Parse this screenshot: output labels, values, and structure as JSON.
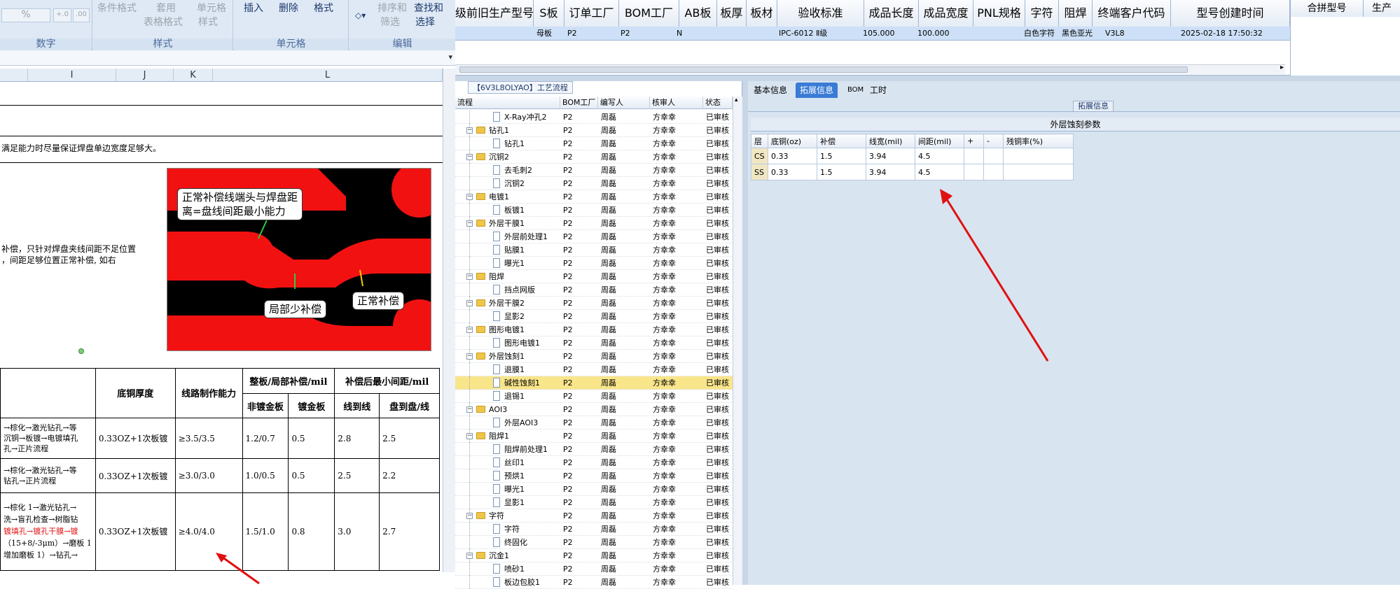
{
  "excel": {
    "ribbon": {
      "groups": [
        {
          "label": "数字",
          "items": [
            "%",
            "+.0",
            ".00"
          ]
        },
        {
          "label": "样式",
          "items": [
            "条件格式",
            "套用",
            "表格格式",
            "单元格",
            "样式"
          ]
        },
        {
          "label": "单元格",
          "items": [
            "插入",
            "删除",
            "格式"
          ]
        },
        {
          "label": "编辑",
          "items": [
            "排序和",
            "筛选",
            "查找和",
            "选择"
          ]
        }
      ]
    },
    "columns": [
      "I",
      "J",
      "K",
      "L"
    ],
    "note_top": "满足能力时尽量保证焊盘单边宽度足够大。",
    "note_left_1": "补偿，只针对焊盘夹线间距不足位置",
    "note_left_2": "，间距足够位置正常补偿, 如右",
    "callouts": {
      "c1_l1": "正常补偿线端头与焊盘距",
      "c1_l2": "离=盘线间距最小能力",
      "c2": "局部少补偿",
      "c3": "正常补偿"
    },
    "table": {
      "h_copper": "底铜厚度",
      "h_capability": "线路制作能力",
      "h_comp": "整板/局部补偿/mil",
      "h_min": "补偿后最小间距/mil",
      "h_nonplated": "非镀金板",
      "h_plated": "镀金板",
      "h_l2l": "线到线",
      "h_p2l": "盘到盘/线",
      "rows": [
        {
          "flow_1": "→棕化→激光钻孔→等",
          "flow_2": "沉铜→板镀→电镀填孔",
          "flow_3": "孔→正片流程",
          "copper": "0.33OZ+1次板镀",
          "cap": "≥3.5/3.5",
          "nonplated": "1.2/0.7",
          "plated": "0.5",
          "l2l": "2.8",
          "p2l": "2.5"
        },
        {
          "flow_1": "→棕化→激光钻孔→等",
          "flow_2": "钻孔→正片流程",
          "flow_3": "",
          "copper": "0.33OZ+1次板镀",
          "cap": "≥3.0/3.0",
          "nonplated": "1.0/0.5",
          "plated": "0.5",
          "l2l": "2.5",
          "p2l": "2.2"
        },
        {
          "flow_1": "→棕化 1→激光钻孔→",
          "flow_2": "洗→盲孔检查→树脂钻",
          "flow_3": "镀填孔→镀孔干膜→镀",
          "flow_4": "（15+8/-3μm）→磨板 1",
          "flow_5": "增加磨板 1）→钻孔→",
          "copper": "0.33OZ+1次板镀",
          "cap": "≥4.0/4.0",
          "nonplated": "1.5/1.0",
          "plated": "0.8",
          "l2l": "3.0",
          "p2l": "2.7"
        }
      ]
    }
  },
  "app": {
    "grid_headers": [
      "级前旧生产型号",
      "S板",
      "订单工厂",
      "BOM工厂",
      "AB板",
      "板厚",
      "板材",
      "验收标准",
      "成品长度",
      "成品宽度",
      "PNL规格",
      "字符",
      "阻焊",
      "终端客户代码",
      "型号创建时间"
    ],
    "grid_row": {
      "s_board": "母板",
      "order_factory": "P2",
      "bom_factory": "P2",
      "ab": "N",
      "standard": "IPC-6012 Ⅱ级",
      "length": "105.000",
      "width": "100.000",
      "char": "白色字符",
      "solder": "黑色亚光",
      "customer": "V3L8",
      "created": "2025-02-18 17:50:32"
    },
    "right_grid_headers": [
      "合拼型号",
      "生产"
    ],
    "tree": {
      "title": "【6V3L8OLYAO】工艺流程",
      "headers": [
        "流程",
        "BOM工厂",
        "编写人",
        "核审人",
        "状态"
      ],
      "rows": [
        {
          "name": "X-Ray冲孔2",
          "type": "doc",
          "level": 2,
          "factory": "P2",
          "writer": "周磊",
          "reviewer": "方幸幸",
          "status": "已审核"
        },
        {
          "name": "钻孔1",
          "type": "folder",
          "level": 1,
          "factory": "P2",
          "writer": "周磊",
          "reviewer": "方幸幸",
          "status": "已审核"
        },
        {
          "name": "钻孔1",
          "type": "doc",
          "level": 2,
          "factory": "P2",
          "writer": "周磊",
          "reviewer": "方幸幸",
          "status": "已审核"
        },
        {
          "name": "沉铜2",
          "type": "folder",
          "level": 1,
          "factory": "P2",
          "writer": "周磊",
          "reviewer": "方幸幸",
          "status": "已审核"
        },
        {
          "name": "去毛刺2",
          "type": "doc",
          "level": 2,
          "factory": "P2",
          "writer": "周磊",
          "reviewer": "方幸幸",
          "status": "已审核"
        },
        {
          "name": "沉铜2",
          "type": "doc",
          "level": 2,
          "factory": "P2",
          "writer": "周磊",
          "reviewer": "方幸幸",
          "status": "已审核"
        },
        {
          "name": "电镀1",
          "type": "folder",
          "level": 1,
          "factory": "P2",
          "writer": "周磊",
          "reviewer": "方幸幸",
          "status": "已审核"
        },
        {
          "name": "板镀1",
          "type": "doc",
          "level": 2,
          "factory": "P2",
          "writer": "周磊",
          "reviewer": "方幸幸",
          "status": "已审核"
        },
        {
          "name": "外层干膜1",
          "type": "folder",
          "level": 1,
          "factory": "P2",
          "writer": "周磊",
          "reviewer": "方幸幸",
          "status": "已审核"
        },
        {
          "name": "外层前处理1",
          "type": "doc",
          "level": 2,
          "factory": "P2",
          "writer": "周磊",
          "reviewer": "方幸幸",
          "status": "已审核"
        },
        {
          "name": "贴膜1",
          "type": "doc",
          "level": 2,
          "factory": "P2",
          "writer": "周磊",
          "reviewer": "方幸幸",
          "status": "已审核"
        },
        {
          "name": "曝光1",
          "type": "doc",
          "level": 2,
          "factory": "P2",
          "writer": "周磊",
          "reviewer": "方幸幸",
          "status": "已审核"
        },
        {
          "name": "阻焊",
          "type": "folder",
          "level": 1,
          "factory": "P2",
          "writer": "周磊",
          "reviewer": "方幸幸",
          "status": "已审核"
        },
        {
          "name": "挡点网版",
          "type": "doc",
          "level": 2,
          "factory": "P2",
          "writer": "周磊",
          "reviewer": "方幸幸",
          "status": "已审核"
        },
        {
          "name": "外层干膜2",
          "type": "folder",
          "level": 1,
          "factory": "P2",
          "writer": "周磊",
          "reviewer": "方幸幸",
          "status": "已审核"
        },
        {
          "name": "显影2",
          "type": "doc",
          "level": 2,
          "factory": "P2",
          "writer": "周磊",
          "reviewer": "方幸幸",
          "status": "已审核"
        },
        {
          "name": "图形电镀1",
          "type": "folder",
          "level": 1,
          "factory": "P2",
          "writer": "周磊",
          "reviewer": "方幸幸",
          "status": "已审核"
        },
        {
          "name": "图形电镀1",
          "type": "doc",
          "level": 2,
          "factory": "P2",
          "writer": "周磊",
          "reviewer": "方幸幸",
          "status": "已审核"
        },
        {
          "name": "外层蚀刻1",
          "type": "folder",
          "level": 1,
          "factory": "P2",
          "writer": "周磊",
          "reviewer": "方幸幸",
          "status": "已审核"
        },
        {
          "name": "退膜1",
          "type": "doc",
          "level": 2,
          "factory": "P2",
          "writer": "周磊",
          "reviewer": "方幸幸",
          "status": "已审核"
        },
        {
          "name": "碱性蚀刻1",
          "type": "doc",
          "level": 2,
          "factory": "P2",
          "writer": "周磊",
          "reviewer": "方幸幸",
          "status": "已审核",
          "selected": true
        },
        {
          "name": "退锡1",
          "type": "doc",
          "level": 2,
          "factory": "P2",
          "writer": "周磊",
          "reviewer": "方幸幸",
          "status": "已审核"
        },
        {
          "name": "AOI3",
          "type": "folder",
          "level": 1,
          "factory": "P2",
          "writer": "周磊",
          "reviewer": "方幸幸",
          "status": "已审核"
        },
        {
          "name": "外层AOI3",
          "type": "doc",
          "level": 2,
          "factory": "P2",
          "writer": "周磊",
          "reviewer": "方幸幸",
          "status": "已审核"
        },
        {
          "name": "阻焊1",
          "type": "folder",
          "level": 1,
          "factory": "P2",
          "writer": "周磊",
          "reviewer": "方幸幸",
          "status": "已审核"
        },
        {
          "name": "阻焊前处理1",
          "type": "doc",
          "level": 2,
          "factory": "P2",
          "writer": "周磊",
          "reviewer": "方幸幸",
          "status": "已审核"
        },
        {
          "name": "丝印1",
          "type": "doc",
          "level": 2,
          "factory": "P2",
          "writer": "周磊",
          "reviewer": "方幸幸",
          "status": "已审核"
        },
        {
          "name": "预烘1",
          "type": "doc",
          "level": 2,
          "factory": "P2",
          "writer": "周磊",
          "reviewer": "方幸幸",
          "status": "已审核"
        },
        {
          "name": "曝光1",
          "type": "doc",
          "level": 2,
          "factory": "P2",
          "writer": "周磊",
          "reviewer": "方幸幸",
          "status": "已审核"
        },
        {
          "name": "显影1",
          "type": "doc",
          "level": 2,
          "factory": "P2",
          "writer": "周磊",
          "reviewer": "方幸幸",
          "status": "已审核"
        },
        {
          "name": "字符",
          "type": "folder",
          "level": 1,
          "factory": "P2",
          "writer": "周磊",
          "reviewer": "方幸幸",
          "status": "已审核"
        },
        {
          "name": "字符",
          "type": "doc",
          "level": 2,
          "factory": "P2",
          "writer": "周磊",
          "reviewer": "方幸幸",
          "status": "已审核"
        },
        {
          "name": "终固化",
          "type": "doc",
          "level": 2,
          "factory": "P2",
          "writer": "周磊",
          "reviewer": "方幸幸",
          "status": "已审核"
        },
        {
          "name": "沉金1",
          "type": "folder",
          "level": 1,
          "factory": "P2",
          "writer": "周磊",
          "reviewer": "方幸幸",
          "status": "已审核"
        },
        {
          "name": "喷砂1",
          "type": "doc",
          "level": 2,
          "factory": "P2",
          "writer": "周磊",
          "reviewer": "方幸幸",
          "status": "已审核"
        },
        {
          "name": "板边包胶1",
          "type": "doc",
          "level": 2,
          "factory": "P2",
          "writer": "周磊",
          "reviewer": "方幸幸",
          "status": "已审核"
        }
      ]
    },
    "tabs": [
      "基本信息",
      "拓展信息",
      "BOM",
      "工时"
    ],
    "active_tab": "拓展信息",
    "expand_label": "拓展信息",
    "param_title": "外层蚀刻参数",
    "param_headers": [
      "层",
      "底铜(oz)",
      "补偿",
      "线宽(mil)",
      "间距(mil)",
      "+",
      "-",
      "残铜率(%)"
    ],
    "param_rows": [
      {
        "layer": "CS",
        "copper": "0.33",
        "comp": "1.5",
        "width": "3.94",
        "gap": "4.5",
        "plus": "",
        "minus": "",
        "residual": ""
      },
      {
        "layer": "SS",
        "copper": "0.33",
        "comp": "1.5",
        "width": "3.94",
        "gap": "4.5",
        "plus": "",
        "minus": "",
        "residual": ""
      }
    ],
    "colors": {
      "accent": "#3a7bd5",
      "selected_row": "#f9e58a",
      "arrow": "#e01010"
    }
  }
}
